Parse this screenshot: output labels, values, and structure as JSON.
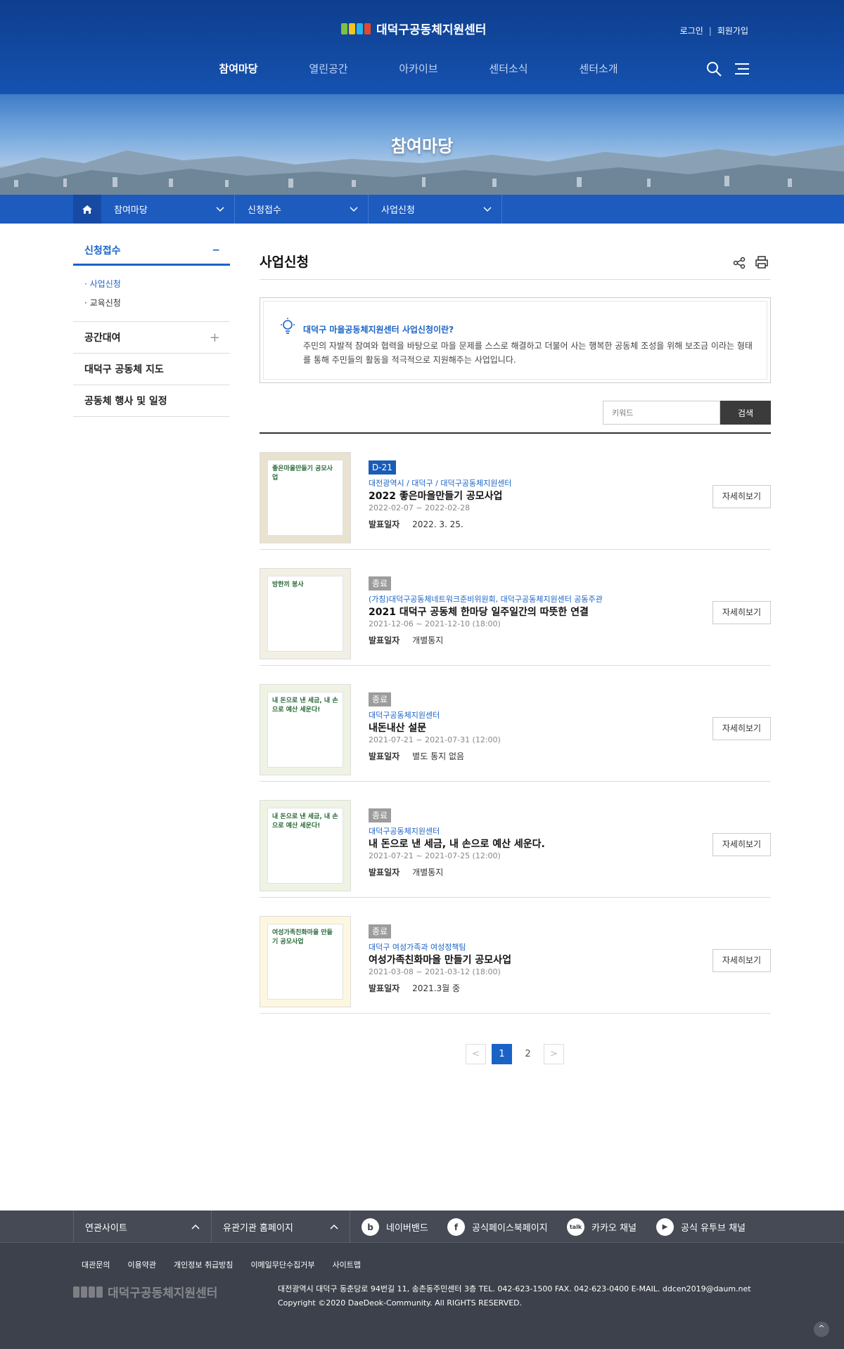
{
  "header": {
    "logo_text": "대덕구공동체지원센터",
    "login": "로그인",
    "separator": "|",
    "signup": "회원가입",
    "nav": [
      "참여마당",
      "열린공간",
      "아카이브",
      "센터소식",
      "센터소개"
    ],
    "active_nav": "참여마당"
  },
  "visual": {
    "title": "참여마당"
  },
  "location": {
    "items": [
      "참여마당",
      "신청접수",
      "사업신청"
    ]
  },
  "lnb": {
    "top": "신청접수",
    "top_symbol": "−",
    "sub": [
      "사업신청",
      "교육신청"
    ],
    "items": [
      {
        "label": "공간대여",
        "symbol": "+"
      },
      {
        "label": "대덕구 공동체 지도",
        "symbol": ""
      },
      {
        "label": "공동체 행사 및 일정",
        "symbol": ""
      }
    ]
  },
  "content": {
    "title": "사업신청",
    "info_title": "대덕구 마을공동체지원센터 사업신청이란?",
    "info_text": "주민의 자발적 참여와 협력을 바탕으로 마을 문제를 스스로 해결하고 더불어 사는 행복한 공동체 조성을 위해 보조금 이라는 형태를 통해 주민들의 활동을 적극적으로 지원해주는 사업입니다.",
    "search_placeholder": "키워드",
    "search_button": "검색",
    "announce_label": "발표일자",
    "detail_label": "자세히보기"
  },
  "rows": [
    {
      "badge": "D-21",
      "status": "open",
      "org": "대전광역시 / 대덕구 / 대덕구공동체지원센터",
      "title": "2022 좋은마을만들기 공모사업",
      "period": "2022-02-07 ~ 2022-02-28",
      "announce": "2022. 3. 25.",
      "thumb_text": "좋은마을만들기 공모사업",
      "thumb_color": "#e8e2cf"
    },
    {
      "badge": "종료",
      "status": "closed",
      "org": "(가칭)대덕구공동체네트워크준비위원회, 대덕구공동체지원센터 공동주관",
      "title": "2021 대덕구 공동체 한마당 일주일간의 따뜻한 연결",
      "period": "2021-12-06 ~ 2021-12-10 (18:00)",
      "announce": "개별통지",
      "thumb_text": "방한끼 봉사",
      "thumb_color": "#f2efe4"
    },
    {
      "badge": "종료",
      "status": "closed",
      "org": "대덕구공동체지원센터",
      "title": "내돈내산 설문",
      "period": "2021-07-21 ~ 2021-07-31 (12:00)",
      "announce": "별도 통지 없음",
      "thumb_text": "내 돈으로 낸 세금, 내 손으로 예산 세운다!",
      "thumb_color": "#eef3e4"
    },
    {
      "badge": "종료",
      "status": "closed",
      "org": "대덕구공동체지원센터",
      "title": "내 돈으로 낸 세금, 내 손으로 예산 세운다.",
      "period": "2021-07-21 ~ 2021-07-25 (12:00)",
      "announce": "개별통지",
      "thumb_text": "내 돈으로 낸 세금, 내 손으로 예산 세운다!",
      "thumb_color": "#eef3e4"
    },
    {
      "badge": "종료",
      "status": "closed",
      "org": "대덕구 여성가족과 여성정책팀",
      "title": "여성가족친화마을 만들기 공모사업",
      "period": "2021-03-08 ~ 2021-03-12 (18:00)",
      "announce": "2021.3월 중",
      "thumb_text": "여성가족친화마을 만들기 공모사업",
      "thumb_color": "#fdf7df"
    }
  ],
  "pagination": {
    "prev": "<",
    "pages": [
      "1",
      "2"
    ],
    "current": "1",
    "next": ">"
  },
  "footer": {
    "related": "연관사이트",
    "orgs": "유관기관 홈페이지",
    "sns": [
      {
        "icon": "b",
        "label": "네이버밴드"
      },
      {
        "icon": "f",
        "label": "공식페이스북페이지"
      },
      {
        "icon": "talk",
        "label": "카카오 채널"
      },
      {
        "icon": "▶",
        "label": "공식 유투브 채널"
      }
    ],
    "links": [
      "대관문의",
      "이용약관",
      "개인정보 취급방침",
      "이메일무단수집거부",
      "사이트맵"
    ],
    "logo_text": "대덕구공동체지원센터",
    "address": "대전광역시 대덕구 동춘당로 94번길 11, 송촌동주민센터 3층   TEL. 042-623-1500   FAX. 042-623-0400   E-MAIL. ddcen2019@daum.net",
    "copyright": "Copyright ©2020 DaeDeok-Community. All RIGHTS RESERVED.",
    "top_button": "^"
  },
  "colors": {
    "primary": "#1a63c6",
    "header": "#0e3e8e",
    "footer": "#3d414b"
  }
}
